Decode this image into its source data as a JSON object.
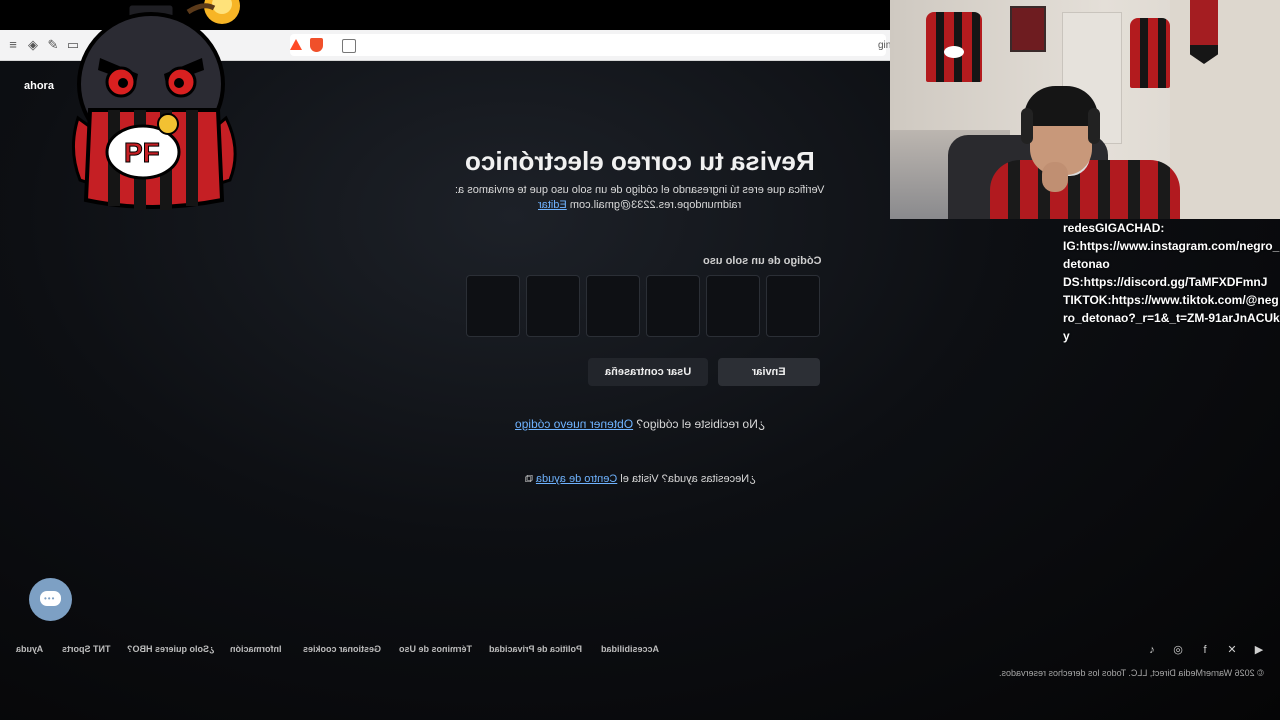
{
  "browser": {
    "url_fragment": "gin",
    "url_fragment_left": "o"
  },
  "header": {
    "ahora_label": "ahora"
  },
  "form": {
    "title": "Revisa tu correo electrónico",
    "subtitle": "Verifica que eres tú ingresando el código de un solo uso que te enviamos a:",
    "email": "raidmundope.res.2233@gmail.com",
    "edit_label": "Editar",
    "code_label": "Código de un solo uso",
    "send_label": "Enviar",
    "use_password_label": "Usar contraseña",
    "resend_prefix": "¿No recibiste el código?",
    "resend_link": "Obtener nuevo código",
    "help_prefix": "¿Necesitas ayuda? Visita el",
    "help_link": "Centro de ayuda"
  },
  "footer": {
    "links": [
      "Ayuda",
      "TNT Sports",
      "¿Solo quieres HBO?",
      "Información",
      "Gestionar cookies",
      "Términos de Uso",
      "Política de Privacidad",
      "Accesibilidad"
    ],
    "copyright": "© 2026 WarnerMedia Direct, LLC. Todos los derechos reservados.",
    "social_icons": [
      "tiktok-icon",
      "instagram-icon",
      "facebook-icon",
      "x-icon",
      "youtube-icon"
    ]
  },
  "mascot": {
    "badge_text": "PF"
  },
  "overlay": {
    "lines": [
      "redesGIGACHAD:",
      "IG:https://www.instagram.com/negro_detonao",
      "DS:https://discord.gg/TaMFXDFmnJ",
      "TIKTOK:https://www.tiktok.com/@negro_detonao?_r=1&_t=ZM-91arJnACUky"
    ]
  },
  "colors": {
    "link": "#6fb3ff",
    "button": "#2c2f35",
    "chat_bubble": "#7da0c4",
    "jersey_red": "#b11a1f"
  }
}
